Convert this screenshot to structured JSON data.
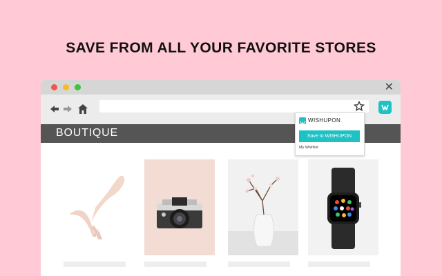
{
  "headline": "SAVE FROM ALL YOUR FAVORITE STORES",
  "browser": {
    "traffic_lights": [
      "red",
      "yellow",
      "green"
    ],
    "close_symbol": "✕",
    "toolbar": {
      "back_icon": "arrow-left-icon",
      "forward_icon": "arrow-right-icon",
      "home_icon": "home-icon",
      "address_value": "",
      "bookmark_icon": "star-icon",
      "extension_icon": "wishupon-icon"
    }
  },
  "site": {
    "title": "BOUTIQUE"
  },
  "popup": {
    "brand": "WISHUPON",
    "save_label": "Save to WISHUPON",
    "wishlist_link": "My Wishlist"
  },
  "products": [
    {
      "name": "pink-heels",
      "background": "#ffffff"
    },
    {
      "name": "vintage-camera",
      "background": "#f3dcd4"
    },
    {
      "name": "vase-with-blossoms",
      "background": "#f1f1f1"
    },
    {
      "name": "smartwatch",
      "background": "#f2f2f2"
    }
  ],
  "colors": {
    "page_background": "#ffc9d6",
    "accent": "#1fc2c4",
    "site_header": "#555555"
  }
}
